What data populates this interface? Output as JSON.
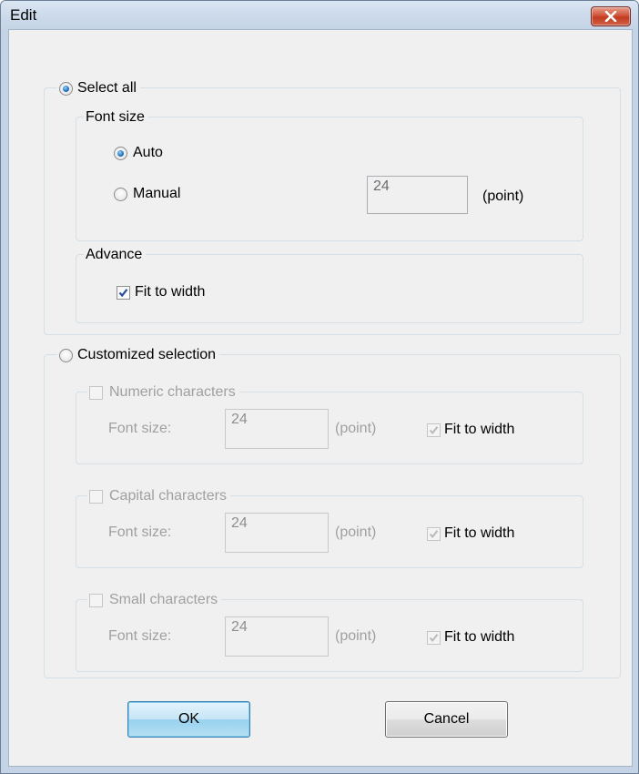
{
  "window": {
    "title": "Edit"
  },
  "select_all": {
    "label": "Select all",
    "checked": true,
    "font_size_group": {
      "title": "Font size",
      "auto_label": "Auto",
      "auto_checked": true,
      "manual_label": "Manual",
      "manual_checked": false,
      "manual_value": "24",
      "unit": "(point)"
    },
    "advance_group": {
      "title": "Advance",
      "fit_to_width_label": "Fit to width",
      "fit_to_width_checked": true
    }
  },
  "customized": {
    "label": "Customized selection",
    "checked": false,
    "groups": [
      {
        "title": "Numeric characters",
        "font_size_label": "Font size:",
        "value": "24",
        "unit": "(point)",
        "fit_label": "Fit to width"
      },
      {
        "title": "Capital characters",
        "font_size_label": "Font size:",
        "value": "24",
        "unit": "(point)",
        "fit_label": "Fit to width"
      },
      {
        "title": "Small characters",
        "font_size_label": "Font size:",
        "value": "24",
        "unit": "(point)",
        "fit_label": "Fit to width"
      }
    ]
  },
  "buttons": {
    "ok": "OK",
    "cancel": "Cancel"
  },
  "colors": {
    "accent_radio": "#1f6fb8",
    "close_button": "#c23b1f",
    "window_frame": "#c4d3e6"
  }
}
